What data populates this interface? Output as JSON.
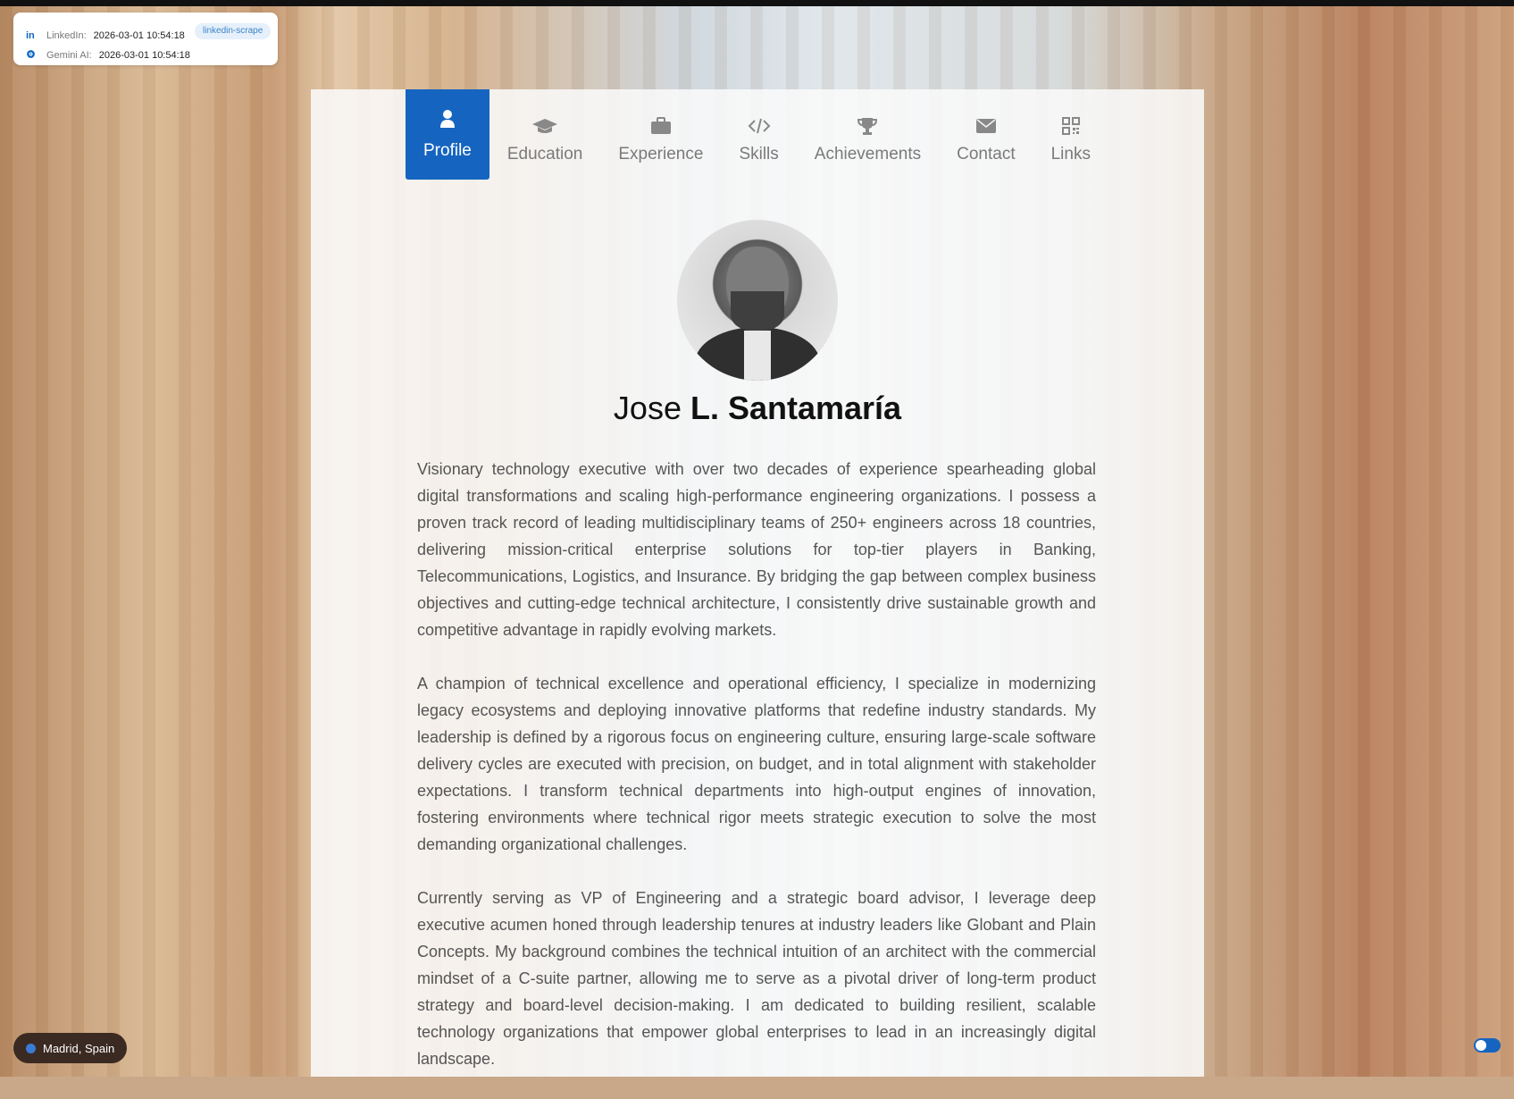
{
  "status": {
    "linkedin_label": "LinkedIn:",
    "linkedin_time": "2026-03-01 10:54:18",
    "badge": "linkedin-scrape",
    "gemini_label": "Gemini AI:",
    "gemini_time": "2026-03-01 10:54:18"
  },
  "tabs": [
    {
      "label": "Profile",
      "icon": "user-icon"
    },
    {
      "label": "Education",
      "icon": "graduation-cap-icon"
    },
    {
      "label": "Experience",
      "icon": "briefcase-icon"
    },
    {
      "label": "Skills",
      "icon": "code-icon"
    },
    {
      "label": "Achievements",
      "icon": "trophy-icon"
    },
    {
      "label": "Contact",
      "icon": "envelope-icon"
    },
    {
      "label": "Links",
      "icon": "qr-code-icon"
    }
  ],
  "profile": {
    "first_name": "Jose",
    "last_name": "L. Santamaría",
    "bio": [
      "Visionary technology executive with over two decades of experience spearheading global digital transformations and scaling high-performance engineering organizations. I possess a proven track record of leading multidisciplinary teams of 250+ engineers across 18 countries, delivering mission-critical enterprise solutions for top-tier players in Banking, Telecommunications, Logistics, and Insurance. By bridging the gap between complex business objectives and cutting-edge technical architecture, I consistently drive sustainable growth and competitive advantage in rapidly evolving markets.",
      "A champion of technical excellence and operational efficiency, I specialize in modernizing legacy ecosystems and deploying innovative platforms that redefine industry standards. My leadership is defined by a rigorous focus on engineering culture, ensuring large-scale software delivery cycles are executed with precision, on budget, and in total alignment with stakeholder expectations. I transform technical departments into high-output engines of innovation, fostering environments where technical rigor meets strategic execution to solve the most demanding organizational challenges.",
      "Currently serving as VP of Engineering and a strategic board advisor, I leverage deep executive acumen honed through leadership tenures at industry leaders like Globant and Plain Concepts. My background combines the technical intuition of an architect with the commercial mindset of a C-suite partner, allowing me to serve as a pivotal driver of long-term product strategy and board-level decision-making. I am dedicated to building resilient, scalable technology organizations that empower global enterprises to lead in an increasingly digital landscape."
    ]
  },
  "location": "Madrid, Spain",
  "colors": {
    "accent": "#1565c0"
  }
}
